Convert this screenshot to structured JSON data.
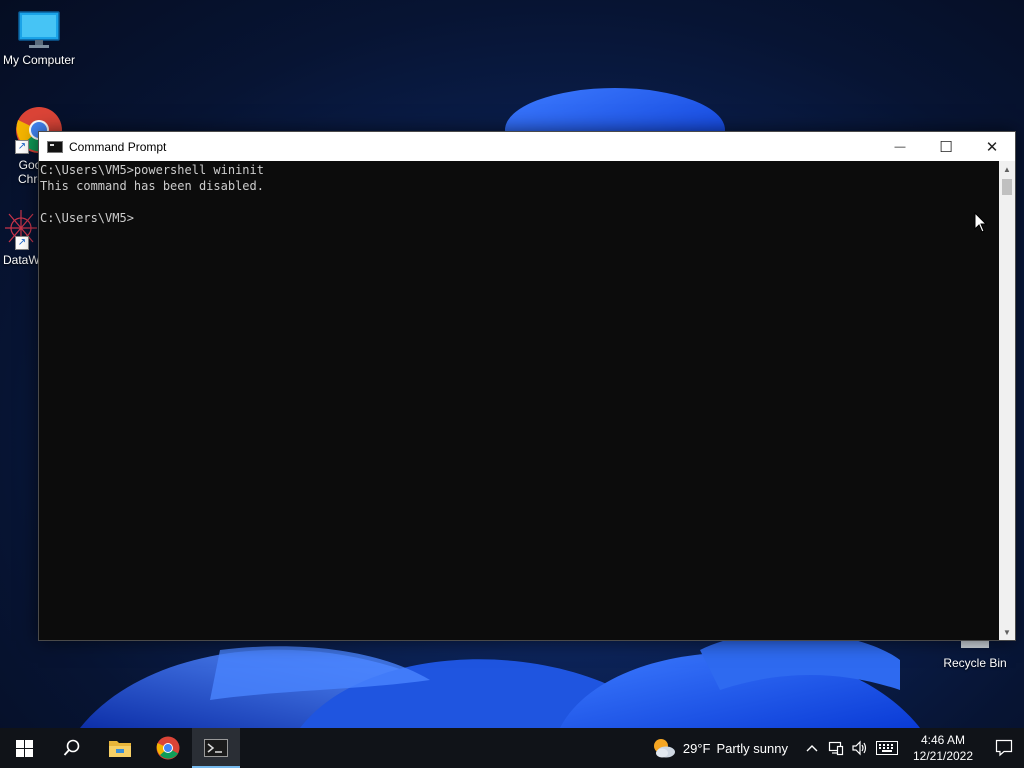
{
  "desktop": {
    "icons": [
      {
        "label": "My Computer"
      },
      {
        "label": "Goo Chro"
      },
      {
        "label": "DataW"
      },
      {
        "label": "Recycle Bin"
      }
    ]
  },
  "window": {
    "title": "Command Prompt",
    "controls": {
      "minimize": "—",
      "maximize": "☐",
      "close": "✕"
    },
    "console_lines": [
      "C:\\Users\\VM5>powershell wininit",
      "This command has been disabled.",
      "",
      "C:\\Users\\VM5>"
    ],
    "scroll_up": "▲",
    "scroll_down": "▼"
  },
  "taskbar": {
    "weather": {
      "temp": "29°F",
      "condition": "Partly sunny"
    },
    "tray": {
      "chevron": "^",
      "network": "⊡",
      "volume": "🔈",
      "keyboard": "⌨"
    },
    "clock": {
      "time": "4:46 AM",
      "date": "12/21/2022"
    }
  },
  "colors": {
    "console_bg": "#0c0c0c",
    "console_fg": "#cccccc",
    "taskbar_bg": "#101318",
    "active_indicator": "#76b9ed"
  }
}
